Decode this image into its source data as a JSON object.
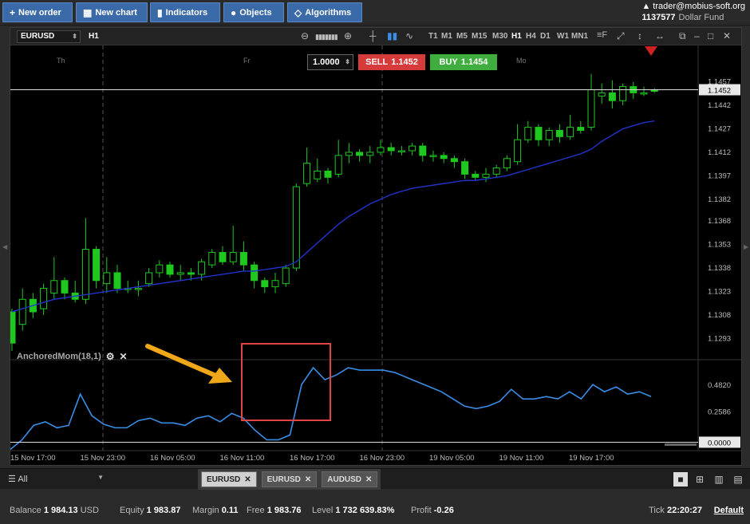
{
  "toolbar": {
    "new_order": "New order",
    "new_chart": "New chart",
    "indicators": "Indicators",
    "objects": "Objects",
    "algorithms": "Algorithms"
  },
  "account": {
    "user": "trader@mobius-soft.org",
    "number": "1137577",
    "fund": "Dollar Fund"
  },
  "chart": {
    "symbol": "EURUSD",
    "timeframe": "H1",
    "timeframes": [
      "T1",
      "M1",
      "M5",
      "M15",
      "M30",
      "H1",
      "H4",
      "D1",
      "W1",
      "MN1"
    ],
    "active_timeframe": "H1",
    "day_labels": [
      "Th",
      "Fr",
      "Mo"
    ],
    "order": {
      "quantity": "1.0000",
      "sell_label": "SELL",
      "sell_price": "1.1452",
      "buy_label": "BUY",
      "buy_price": "1.1454"
    },
    "price_ticks": [
      "1.1457",
      "1.1442",
      "1.1427",
      "1.1412",
      "1.1397",
      "1.1382",
      "1.1368",
      "1.1353",
      "1.1338",
      "1.1323",
      "1.1308",
      "1.1293"
    ],
    "current_price": "1.1452",
    "indicator_label": "AnchoredMom(18,1)",
    "indicator_ticks": [
      "0.4820",
      "0.2586",
      "0.0000"
    ],
    "time_labels": [
      "15 Nov 17:00",
      "15 Nov 23:00",
      "16 Nov 05:00",
      "16 Nov 11:00",
      "16 Nov 17:00",
      "16 Nov 23:00",
      "19 Nov 05:00",
      "19 Nov 11:00",
      "19 Nov 17:00"
    ]
  },
  "tabs": {
    "filter": "All",
    "items": [
      "EURUSD",
      "EURUSD",
      "AUDUSD"
    ]
  },
  "status": {
    "balance_label": "Balance",
    "balance": "1 984.13",
    "balance_ccy": "USD",
    "equity_label": "Equity",
    "equity": "1 983.87",
    "margin_label": "Margin",
    "margin": "0.11",
    "free_label": "Free",
    "free": "1 983.76",
    "level_label": "Level",
    "level": "1 732 639.83%",
    "profit_label": "Profit",
    "profit": "-0.26",
    "tick_label": "Tick",
    "tick": "22:20:27",
    "default_label": "Default"
  },
  "colors": {
    "bull": "#1fc81f",
    "bear": "#1fc81f",
    "ma": "#2233cc",
    "momentum": "#3a8ee6",
    "highlight": "#e04444",
    "arrow": "#f0a81a",
    "sell": "#d63b3b",
    "buy": "#3fae3f"
  },
  "chart_data": [
    {
      "type": "candlestick",
      "title": "",
      "y_range": [
        1.1285,
        1.1465
      ],
      "candles": [
        [
          1.131,
          1.129,
          1.1312,
          1.1285
        ],
        [
          1.1302,
          1.1318,
          1.1325,
          1.1298
        ],
        [
          1.1318,
          1.131,
          1.1322,
          1.1306
        ],
        [
          1.1312,
          1.1325,
          1.1328,
          1.1308
        ],
        [
          1.1322,
          1.133,
          1.1345,
          1.1318
        ],
        [
          1.133,
          1.1322,
          1.1332,
          1.1318
        ],
        [
          1.1322,
          1.1318,
          1.133,
          1.1316
        ],
        [
          1.1318,
          1.135,
          1.137,
          1.1315
        ],
        [
          1.135,
          1.133,
          1.1352,
          1.1325
        ],
        [
          1.1328,
          1.1335,
          1.1345,
          1.1322
        ],
        [
          1.1335,
          1.1325,
          1.134,
          1.1322
        ],
        [
          1.1325,
          1.1325,
          1.133,
          1.1322
        ],
        [
          1.1325,
          1.1325,
          1.133,
          1.132
        ],
        [
          1.1328,
          1.1335,
          1.1338,
          1.1326
        ],
        [
          1.1335,
          1.134,
          1.1343,
          1.1332
        ],
        [
          1.134,
          1.1334,
          1.1342,
          1.1332
        ],
        [
          1.1334,
          1.1335,
          1.134,
          1.133
        ],
        [
          1.1335,
          1.1334,
          1.1338,
          1.133
        ],
        [
          1.1334,
          1.1342,
          1.1344,
          1.133
        ],
        [
          1.134,
          1.1348,
          1.135,
          1.1338
        ],
        [
          1.1348,
          1.1342,
          1.1352,
          1.134
        ],
        [
          1.1342,
          1.1348,
          1.1365,
          1.134
        ],
        [
          1.1348,
          1.134,
          1.1355,
          1.1336
        ],
        [
          1.134,
          1.133,
          1.1342,
          1.1325
        ],
        [
          1.133,
          1.1326,
          1.1332,
          1.1322
        ],
        [
          1.1326,
          1.133,
          1.1335,
          1.1322
        ],
        [
          1.1328,
          1.1338,
          1.134,
          1.1326
        ],
        [
          1.1338,
          1.139,
          1.1392,
          1.1336
        ],
        [
          1.1392,
          1.1405,
          1.1415,
          1.139
        ],
        [
          1.1395,
          1.14,
          1.1408,
          1.1393
        ],
        [
          1.14,
          1.1396,
          1.1402,
          1.1392
        ],
        [
          1.1398,
          1.141,
          1.142,
          1.1396
        ],
        [
          1.141,
          1.1412,
          1.1418,
          1.1405
        ],
        [
          1.1412,
          1.141,
          1.1414,
          1.1406
        ],
        [
          1.141,
          1.1412,
          1.1416,
          1.1405
        ],
        [
          1.1412,
          1.1415,
          1.142,
          1.141
        ],
        [
          1.1415,
          1.1413,
          1.1418,
          1.141
        ],
        [
          1.1413,
          1.1413,
          1.1416,
          1.141
        ],
        [
          1.1413,
          1.1416,
          1.1418,
          1.141
        ],
        [
          1.1416,
          1.141,
          1.1418,
          1.1406
        ],
        [
          1.141,
          1.141,
          1.1413,
          1.1406
        ],
        [
          1.141,
          1.1408,
          1.1412,
          1.1405
        ],
        [
          1.1408,
          1.1406,
          1.141,
          1.1402
        ],
        [
          1.1406,
          1.1398,
          1.1408,
          1.1395
        ],
        [
          1.1398,
          1.1396,
          1.14,
          1.1394
        ],
        [
          1.1396,
          1.1398,
          1.1402,
          1.1393
        ],
        [
          1.1398,
          1.1402,
          1.1404,
          1.1396
        ],
        [
          1.1402,
          1.1408,
          1.141,
          1.14
        ],
        [
          1.1406,
          1.142,
          1.143,
          1.1404
        ],
        [
          1.142,
          1.1428,
          1.1432,
          1.1418
        ],
        [
          1.1428,
          1.142,
          1.143,
          1.1416
        ],
        [
          1.142,
          1.1426,
          1.1428,
          1.1416
        ],
        [
          1.1426,
          1.1422,
          1.143,
          1.1418
        ],
        [
          1.1422,
          1.1428,
          1.1436,
          1.142
        ],
        [
          1.1428,
          1.1426,
          1.1432,
          1.1424
        ],
        [
          1.1428,
          1.1452,
          1.1462,
          1.1426
        ],
        [
          1.1448,
          1.145,
          1.1456,
          1.1443
        ],
        [
          1.145,
          1.1445,
          1.1458,
          1.144
        ],
        [
          1.1445,
          1.1454,
          1.1456,
          1.1442
        ],
        [
          1.1454,
          1.145,
          1.1457,
          1.1446
        ],
        [
          1.145,
          1.145,
          1.1454,
          1.1448
        ],
        [
          1.1452,
          1.1451,
          1.1453,
          1.145
        ]
      ],
      "moving_average": [
        1.131,
        1.1312,
        1.1314,
        1.1316,
        1.1318,
        1.1319,
        1.132,
        1.1321,
        1.1322,
        1.1323,
        1.1324,
        1.1325,
        1.1326,
        1.1327,
        1.1328,
        1.1329,
        1.133,
        1.1331,
        1.1332,
        1.1333,
        1.1334,
        1.1335,
        1.1336,
        1.1336,
        1.1337,
        1.1338,
        1.1339,
        1.1342,
        1.1348,
        1.1354,
        1.136,
        1.1366,
        1.1371,
        1.1375,
        1.1379,
        1.1382,
        1.1385,
        1.1387,
        1.1389,
        1.139,
        1.1391,
        1.1392,
        1.1393,
        1.1394,
        1.1394,
        1.1395,
        1.1396,
        1.1397,
        1.1399,
        1.1401,
        1.1403,
        1.1405,
        1.1407,
        1.1409,
        1.1411,
        1.1414,
        1.1419,
        1.1423,
        1.1427,
        1.1429,
        1.1431,
        1.1432
      ]
    },
    {
      "type": "line",
      "title": "AnchoredMom(18,1)",
      "y_range": [
        -0.07,
        0.68
      ],
      "series": [
        {
          "values": [
            -0.06,
            0.02,
            0.14,
            0.17,
            0.12,
            0.14,
            0.4,
            0.22,
            0.15,
            0.12,
            0.12,
            0.18,
            0.2,
            0.16,
            0.16,
            0.14,
            0.2,
            0.22,
            0.17,
            0.24,
            0.2,
            0.1,
            0.02,
            0.02,
            0.06,
            0.48,
            0.62,
            0.52,
            0.56,
            0.62,
            0.6,
            0.6,
            0.6,
            0.58,
            0.54,
            0.5,
            0.46,
            0.42,
            0.36,
            0.3,
            0.28,
            0.3,
            0.34,
            0.44,
            0.36,
            0.36,
            0.38,
            0.36,
            0.42,
            0.36,
            0.48,
            0.42,
            0.46,
            0.4,
            0.42,
            0.38
          ]
        }
      ]
    }
  ]
}
